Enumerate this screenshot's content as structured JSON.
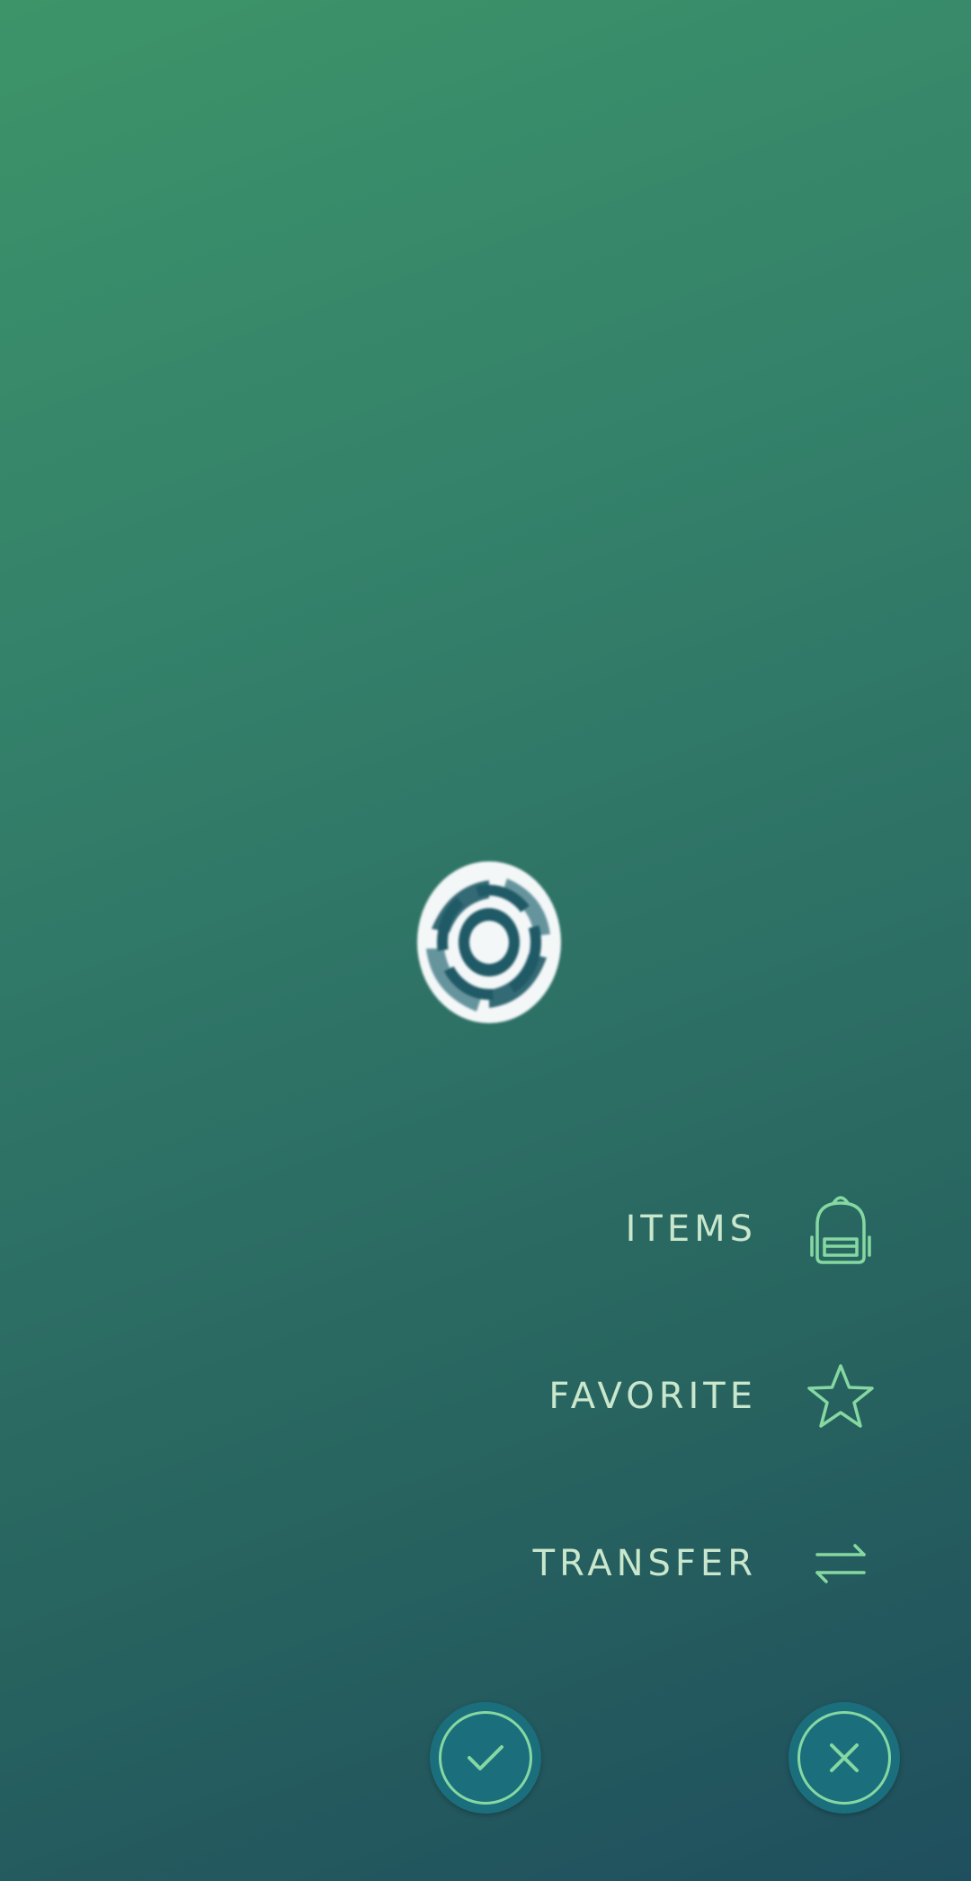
{
  "menu": {
    "items_label": "ITEMS",
    "favorite_label": "FAVORITE",
    "transfer_label": "TRANSFER"
  },
  "icons": {
    "items": "backpack-icon",
    "favorite": "star-icon",
    "transfer": "transfer-arrows-icon",
    "confirm": "checkmark-icon",
    "close": "close-icon",
    "loading": "loading-spinner-icon"
  },
  "colors": {
    "label_text": "#c9e7cc",
    "icon_accent": "#86d8a2",
    "button_fill": "#1b6f7c",
    "background_top": "#3d9469",
    "background_bottom": "#1f4f5e"
  }
}
